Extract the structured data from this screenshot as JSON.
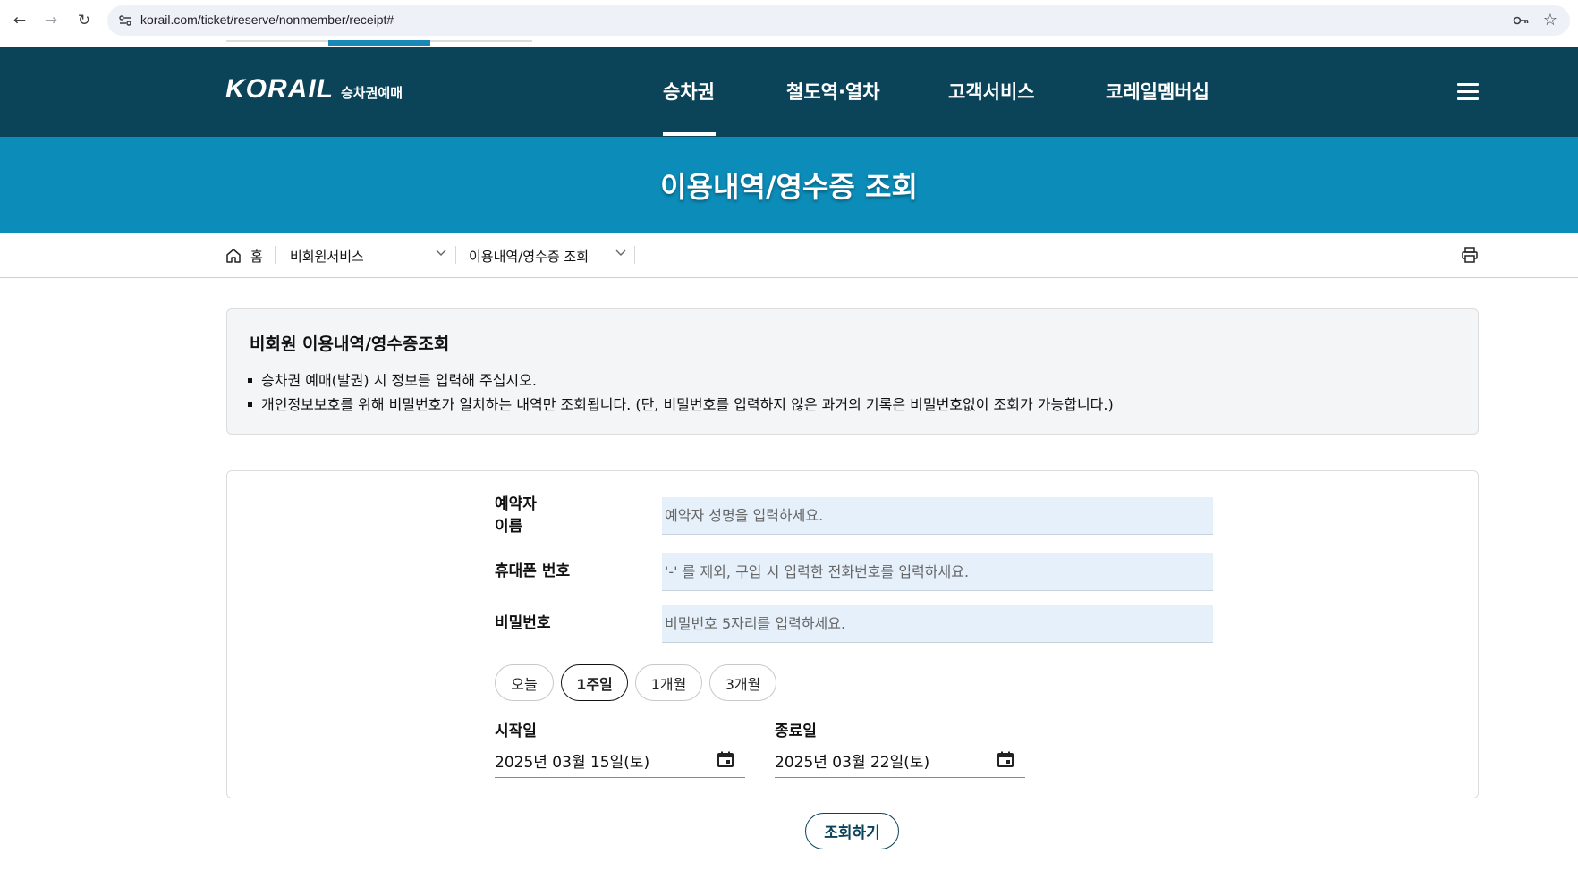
{
  "browser": {
    "url": "korail.com/ticket/reserve/nonmember/receipt#"
  },
  "header": {
    "logo_text": "KORAIL",
    "logo_sub": "승차권예매",
    "nav": [
      {
        "label": "승차권",
        "active": true
      },
      {
        "label": "철도역·열차",
        "active": false
      },
      {
        "label": "고객서비스",
        "active": false
      },
      {
        "label": "코레일멤버십",
        "active": false
      }
    ]
  },
  "page_title": "이용내역/영수증 조회",
  "breadcrumb": {
    "home": "홈",
    "level1": "비회원서비스",
    "level2": "이용내역/영수증 조회"
  },
  "info": {
    "title": "비회원 이용내역/영수증조회",
    "bullets": [
      "승차권 예매(발권) 시 정보를 입력해 주십시오.",
      "개인정보보호를 위해 비밀번호가 일치하는 내역만 조회됩니다. (단, 비밀번호를 입력하지 않은 과거의 기록은 비밀번호없이 조회가 가능합니다.)"
    ]
  },
  "form": {
    "name_label_line1": "예약자",
    "name_label_line2": "이름",
    "name_placeholder": "예약자 성명을 입력하세요.",
    "phone_label": "휴대폰 번호",
    "phone_placeholder": "'-' 를 제외, 구입 시 입력한 전화번호를 입력하세요.",
    "password_label": "비밀번호",
    "password_placeholder": "비밀번호 5자리를 입력하세요.",
    "periods": [
      {
        "label": "오늘",
        "active": false
      },
      {
        "label": "1주일",
        "active": true
      },
      {
        "label": "1개월",
        "active": false
      },
      {
        "label": "3개월",
        "active": false
      }
    ],
    "start_label": "시작일",
    "start_date": "2025년 03월 15일(토)",
    "end_label": "종료일",
    "end_date": "2025년 03월 22일(토)"
  },
  "search_button": "조회하기",
  "colors": {
    "header_bg": "#0b4458",
    "title_band_bg": "#0c8cb8",
    "input_bg": "#e6f0fb"
  }
}
